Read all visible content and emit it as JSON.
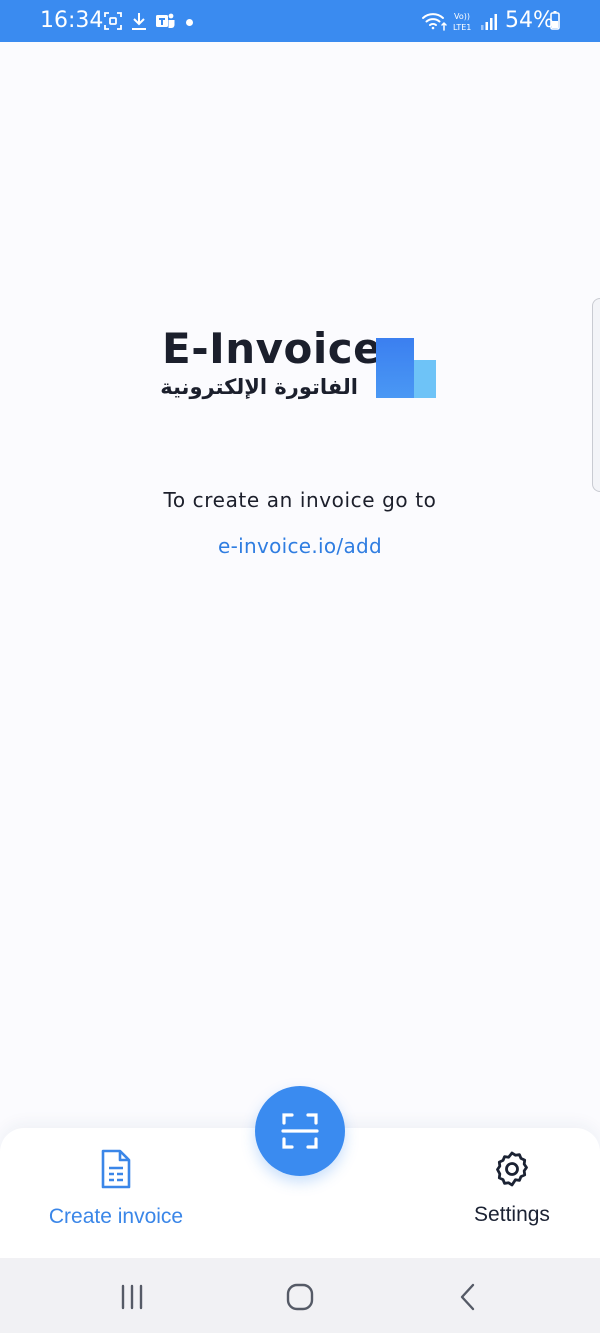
{
  "status_bar": {
    "time": "16:34",
    "battery": "54%",
    "background_color": "#3a8bf0",
    "icons": [
      "screenshot-icon",
      "download-icon",
      "teams-icon",
      "notification-dot",
      "wifi-icon",
      "volte-lte-icon",
      "signal-icon",
      "battery-icon"
    ],
    "network_label_top": "Vo))",
    "network_label_bottom": "LTE1"
  },
  "logo": {
    "title": "E-Invoice",
    "subtitle_arabic": "الفاتورة الإلكترونية",
    "mark_colors": [
      "#3a7ff0",
      "#6ec3f7"
    ]
  },
  "main": {
    "instruction": "To create an invoice go to",
    "link": "e-invoice.io/add",
    "link_color": "#2f7de1"
  },
  "bottom_nav": {
    "create_label": "Create invoice",
    "settings_label": "Settings",
    "scan_icon": "scan-icon",
    "accent_color": "#3a8bf0"
  },
  "system_nav": {
    "buttons": [
      "recent-apps-icon",
      "home-icon",
      "back-icon"
    ]
  }
}
